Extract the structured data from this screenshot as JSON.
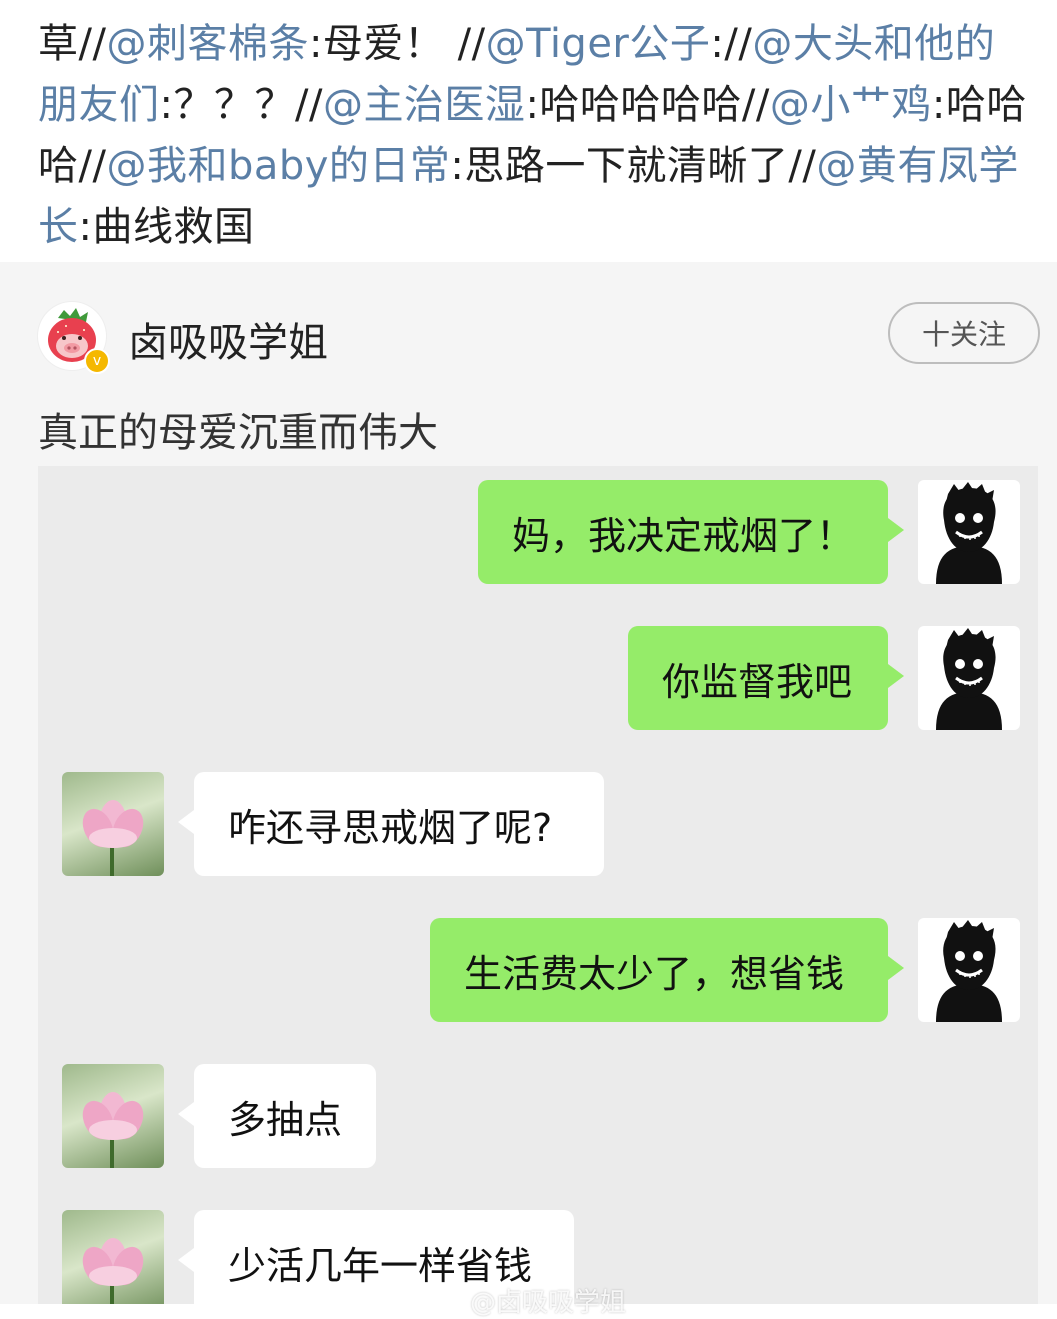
{
  "repost": {
    "segments": [
      {
        "text": "草//",
        "mention": false
      },
      {
        "text": "@刺客棉条",
        "mention": true
      },
      {
        "text": ":母爱！ //",
        "mention": false
      },
      {
        "text": "@Tiger公子",
        "mention": true
      },
      {
        "text": "://",
        "mention": false
      },
      {
        "text": "@大头和他的朋友们",
        "mention": true
      },
      {
        "text": ":？？？//",
        "mention": false
      },
      {
        "text": "@主治医湿",
        "mention": true
      },
      {
        "text": ":哈哈哈哈哈//",
        "mention": false
      },
      {
        "text": "@小艹鸡",
        "mention": true
      },
      {
        "text": ":哈哈哈//",
        "mention": false
      },
      {
        "text": "@我和baby的日常",
        "mention": true
      },
      {
        "text": ":思路一下就清晰了//",
        "mention": false
      },
      {
        "text": "@黄有凤学长",
        "mention": true
      },
      {
        "text": ":曲线救国",
        "mention": false
      }
    ]
  },
  "post": {
    "username": "卤吸吸学姐",
    "verified_badge": "v",
    "follow_label": "十关注",
    "text": "真正的母爱沉重而伟大"
  },
  "chat": {
    "messages": [
      {
        "side": "out",
        "text": "妈，我决定戒烟了！",
        "avatar": "shadow-face-icon"
      },
      {
        "side": "out",
        "text": "你监督我吧",
        "avatar": "shadow-face-icon"
      },
      {
        "side": "in",
        "text": "咋还寻思戒烟了呢?",
        "avatar": "lotus-flower-icon"
      },
      {
        "side": "out",
        "text": "生活费太少了，想省钱",
        "avatar": "shadow-face-icon"
      },
      {
        "side": "in",
        "text": "多抽点",
        "avatar": "lotus-flower-icon"
      },
      {
        "side": "in",
        "text": "少活几年一样省钱",
        "avatar": "lotus-flower-icon"
      }
    ]
  },
  "watermark": "@卤吸吸学姐",
  "colors": {
    "mention": "#5b7fa6",
    "bubble_out": "#95ec69",
    "bubble_in": "#ffffff",
    "chat_bg": "#ebebeb"
  }
}
